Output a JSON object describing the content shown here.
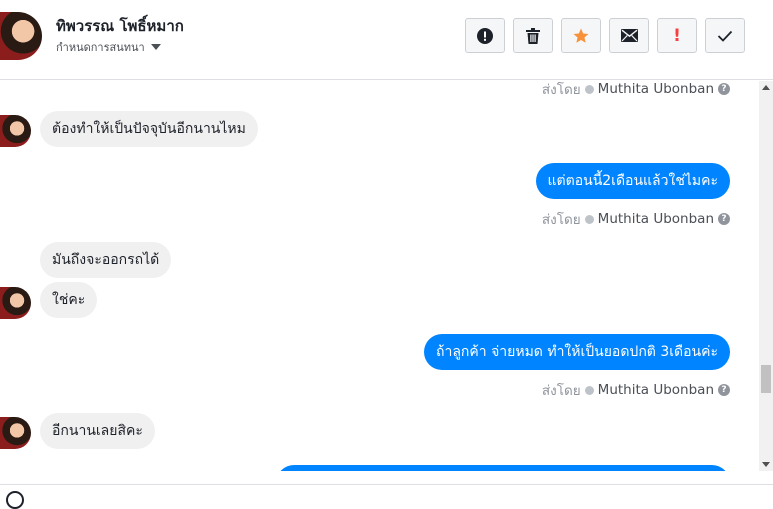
{
  "contact": {
    "name": "ทิพวรรณ โพธิ์หมาก",
    "subtitle": "กำหนดการสนทนา"
  },
  "actions": [
    {
      "icon": "alert-circle-icon",
      "label": "!"
    },
    {
      "icon": "trash-icon"
    },
    {
      "icon": "star-icon",
      "color": "#f7923a"
    },
    {
      "icon": "envelope-icon"
    },
    {
      "icon": "exclamation-icon",
      "label": "!",
      "color": "#fa3e3e"
    },
    {
      "icon": "checkmark-icon",
      "label": "✓"
    }
  ],
  "sent_by_prefix": "ส่งโดย",
  "sent_by_name": "Muthita Ubonban",
  "help_glyph": "?",
  "messages": {
    "m1": "ต้องทำให้เป็นปัจจุบันอีกนานไหม",
    "m2": "แต่ตอนนี้2เดือนแล้วใช่ไมคะ",
    "m3": "มันถึงจะออกรถได้",
    "m4": "ใช่คะ",
    "m5": "ถ้าลูกค้า จ่ายหมด ทำให้เป็นยอดปกติ 3เดือนค่ะ",
    "m6": "อีกนานเลยสิคะ",
    "m7": ""
  },
  "colors": {
    "outgoing_bubble": "#0084ff",
    "incoming_bubble": "#f1f0f0"
  }
}
